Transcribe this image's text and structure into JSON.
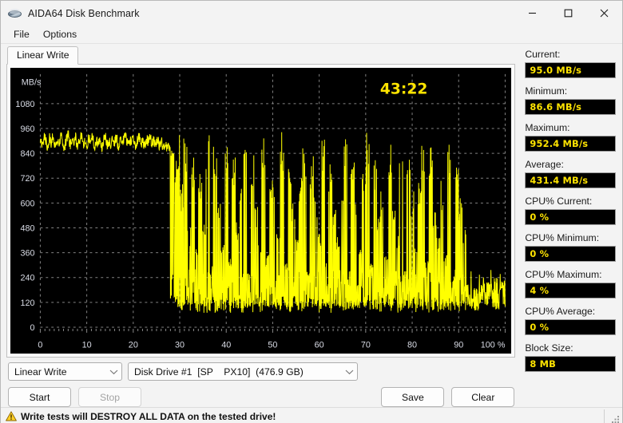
{
  "window": {
    "title": "AIDA64 Disk Benchmark",
    "icon": "disk-icon",
    "minimize_label": "Minimize",
    "maximize_label": "Maximize",
    "close_label": "Close"
  },
  "menu": {
    "items": [
      {
        "label": "File"
      },
      {
        "label": "Options"
      }
    ]
  },
  "tabs": [
    {
      "label": "Linear Write",
      "active": true
    }
  ],
  "chart": {
    "timer": "43:22",
    "y_axis_unit": "MB/s",
    "x_axis_unit": "%"
  },
  "chart_data": {
    "type": "line",
    "title": "Linear Write",
    "xlabel": "%",
    "ylabel": "MB/s",
    "xlim": [
      0,
      100
    ],
    "ylim": [
      0,
      1200
    ],
    "xticks": [
      0,
      10,
      20,
      30,
      40,
      50,
      60,
      70,
      80,
      90,
      100
    ],
    "xticklabels": [
      "0",
      "10",
      "20",
      "30",
      "40",
      "50",
      "60",
      "70",
      "80",
      "90",
      "100 %"
    ],
    "yticks": [
      0,
      120,
      240,
      360,
      480,
      600,
      720,
      840,
      960,
      1080
    ],
    "yticklabels": [
      "0",
      "120",
      "240",
      "360",
      "480",
      "600",
      "720",
      "840",
      "960",
      "1080"
    ],
    "grid": true,
    "grid_style": "dashed",
    "line_color": "#ffff00",
    "background": "#000000",
    "axis_text_color": "#d9dce6",
    "legend": null,
    "annotations": [
      {
        "text": "43:22",
        "x": 47,
        "y": 1130,
        "color": "#ffe400",
        "role": "elapsed-time"
      }
    ],
    "series": [
      {
        "name": "Linear Write throughput",
        "description": "Steady ~900 MB/s SLC-cache plateau up to ~28%, then highly erratic post-cache writes oscillating between ~90 and ~950 MB/s for the remainder.",
        "x": [
          0.0,
          0.4,
          0.8,
          1.2,
          1.6,
          2.0,
          2.4,
          2.8,
          3.2,
          3.6,
          4.0,
          4.4,
          4.8,
          5.2,
          5.6,
          6.0,
          6.4,
          6.8,
          7.2,
          7.6,
          8.0,
          8.4,
          8.8,
          9.2,
          9.6,
          10.0,
          10.4,
          10.8,
          11.2,
          11.6,
          12.0,
          12.4,
          12.8,
          13.2,
          13.6,
          14.0,
          14.4,
          14.8,
          15.2,
          15.6,
          16.0,
          16.4,
          16.8,
          17.2,
          17.6,
          18.0,
          18.4,
          18.8,
          19.2,
          19.6,
          20.0,
          20.4,
          20.8,
          21.2,
          21.6,
          22.0,
          22.4,
          22.8,
          23.2,
          23.6,
          24.0,
          24.4,
          24.8,
          25.2,
          25.6,
          26.0,
          26.4,
          26.8,
          27.2,
          27.6,
          28.0,
          28.4,
          28.8,
          29.2,
          29.6,
          30.0,
          30.4,
          30.8,
          31.2,
          31.6,
          32.0,
          32.4,
          32.8,
          33.2,
          33.6,
          34.0,
          34.4,
          34.8,
          35.2,
          35.6,
          36.0,
          36.4,
          36.8,
          37.2,
          37.6,
          38.0,
          38.4,
          38.8,
          39.2,
          39.6,
          40.0,
          40.4,
          40.8,
          41.2,
          41.6,
          42.0,
          42.4,
          42.8,
          43.2,
          43.6,
          44.0,
          44.4,
          44.8,
          45.2,
          45.6,
          46.0,
          46.4,
          46.8,
          47.2,
          47.6,
          48.0,
          48.4,
          48.8,
          49.2,
          49.6,
          50.0,
          50.4,
          50.8,
          51.2,
          51.6,
          52.0,
          52.4,
          52.8,
          53.2,
          53.6,
          54.0,
          54.4,
          54.8,
          55.2,
          55.6,
          56.0,
          56.4,
          56.8,
          57.2,
          57.6,
          58.0,
          58.4,
          58.8,
          59.2,
          59.6,
          60.0,
          60.4,
          60.8,
          61.2,
          61.6,
          62.0,
          62.4,
          62.8,
          63.2,
          63.6,
          64.0,
          64.4,
          64.8,
          65.2,
          65.6,
          66.0,
          66.4,
          66.8,
          67.2,
          67.6,
          68.0,
          68.4,
          68.8,
          69.2,
          69.6,
          70.0,
          70.4,
          70.8,
          71.2,
          71.6,
          72.0,
          72.4,
          72.8,
          73.2,
          73.6,
          74.0,
          74.4,
          74.8,
          75.2,
          75.6,
          76.0,
          76.4,
          76.8,
          77.2,
          77.6,
          78.0,
          78.4,
          78.8,
          79.2,
          79.6,
          80.0,
          80.4,
          80.8,
          81.2,
          81.6,
          82.0,
          82.4,
          82.8,
          83.2,
          83.6,
          84.0,
          84.4,
          84.8,
          85.2,
          85.6,
          86.0,
          86.4,
          86.8,
          87.2,
          87.6,
          88.0,
          88.4,
          88.8,
          89.2,
          89.6,
          90.0,
          90.4,
          90.8,
          91.2,
          91.6,
          92.0,
          92.4,
          92.8,
          93.2,
          93.6,
          94.0,
          94.4,
          94.8,
          95.2,
          95.6,
          96.0,
          96.4,
          96.8,
          97.2,
          97.6,
          98.0,
          98.4,
          98.8,
          99.2,
          99.6,
          100.0
        ],
        "y": [
          905,
          880,
          922,
          895,
          868,
          915,
          890,
          930,
          872,
          900,
          884,
          925,
          893,
          866,
          910,
          936,
          878,
          902,
          889,
          918,
          872,
          895,
          930,
          884,
          906,
          868,
          912,
          892,
          926,
          874,
          900,
          888,
          918,
          864,
          905,
          932,
          880,
          898,
          872,
          915,
          890,
          925,
          868,
          902,
          884,
          910,
          938,
          876,
          900,
          890,
          920,
          870,
          898,
          928,
          882,
          908,
          866,
          912,
          894,
          930,
          876,
          900,
          886,
          916,
          870,
          904,
          860,
          895,
          874,
          866,
          850,
          842,
          820,
          150,
          948,
          120,
          700,
          110,
          930,
          130,
          480,
          105,
          860,
          115,
          390,
          100,
          760,
          125,
          560,
          95,
          940,
          108,
          300,
          118,
          880,
          98,
          640,
          112,
          410,
          102,
          950,
          126,
          330,
          96,
          820,
          114,
          520,
          104,
          700,
          99,
          900,
          122,
          260,
          116,
          870,
          101,
          600,
          128,
          440,
          97,
          935,
          110,
          350,
          120,
          790,
          103,
          680,
          107,
          490,
          93,
          945,
          119,
          310,
          113,
          850,
          100,
          620,
          124,
          430,
          106,
          720,
          98,
          910,
          117,
          280,
          111,
          830,
          94,
          660,
          123,
          470,
          102,
          940,
          109,
          340,
          115,
          800,
          97,
          590,
          127,
          450,
          105,
          690,
          99,
          920,
          112,
          290,
          118,
          860,
          96,
          630,
          121,
          410,
          108,
          760,
          101,
          950,
          114,
          320,
          104,
          840,
          110,
          550,
          95,
          700,
          116,
          380,
          106,
          890,
          100,
          610,
          122,
          460,
          98,
          930,
          107,
          270,
          113,
          810,
          103,
          670,
          119,
          420,
          92,
          750,
          109,
          940,
          115,
          330,
          101,
          870,
          105,
          580,
          120,
          440,
          97,
          710,
          111,
          360,
          99,
          900,
          106,
          250,
          114,
          790,
          102,
          650,
          118,
          480,
          96,
          160,
          125,
          140,
          110,
          190,
          104,
          170,
          130,
          210,
          145,
          135,
          220,
          155,
          180,
          125,
          240,
          115,
          165,
          190,
          230,
          120,
          175,
          200,
          140,
          110,
          95,
          185,
          150,
          240,
          130,
          105,
          160,
          195,
          120,
          220,
          140,
          175,
          100
        ]
      }
    ]
  },
  "stats": [
    {
      "label": "Current:",
      "value": "95.0 MB/s",
      "name": "current"
    },
    {
      "label": "Minimum:",
      "value": "86.6 MB/s",
      "name": "minimum"
    },
    {
      "label": "Maximum:",
      "value": "952.4 MB/s",
      "name": "maximum"
    },
    {
      "label": "Average:",
      "value": "431.4 MB/s",
      "name": "average"
    },
    {
      "label": "CPU% Current:",
      "value": "0 %",
      "name": "cpu-current"
    },
    {
      "label": "CPU% Minimum:",
      "value": "0 %",
      "name": "cpu-minimum"
    },
    {
      "label": "CPU% Maximum:",
      "value": "4 %",
      "name": "cpu-maximum"
    },
    {
      "label": "CPU% Average:",
      "value": "0 %",
      "name": "cpu-average"
    },
    {
      "label": "Block Size:",
      "value": "8 MB",
      "name": "block-size"
    }
  ],
  "controls": {
    "mode_select": {
      "value": "Linear Write"
    },
    "drive_select": {
      "value": "Disk Drive #1  [SP    PX10]  (476.9 GB)"
    },
    "start_label": "Start",
    "stop_label": "Stop",
    "save_label": "Save",
    "clear_label": "Clear"
  },
  "status": {
    "warning_icon": "warning-triangle-icon",
    "text": "Write tests will DESTROY ALL DATA on the tested drive!"
  },
  "colors": {
    "accent_yellow": "#ffe400",
    "plot_line": "#ffff00",
    "plot_bg": "#000000",
    "window_bg": "#f3f3f3"
  }
}
